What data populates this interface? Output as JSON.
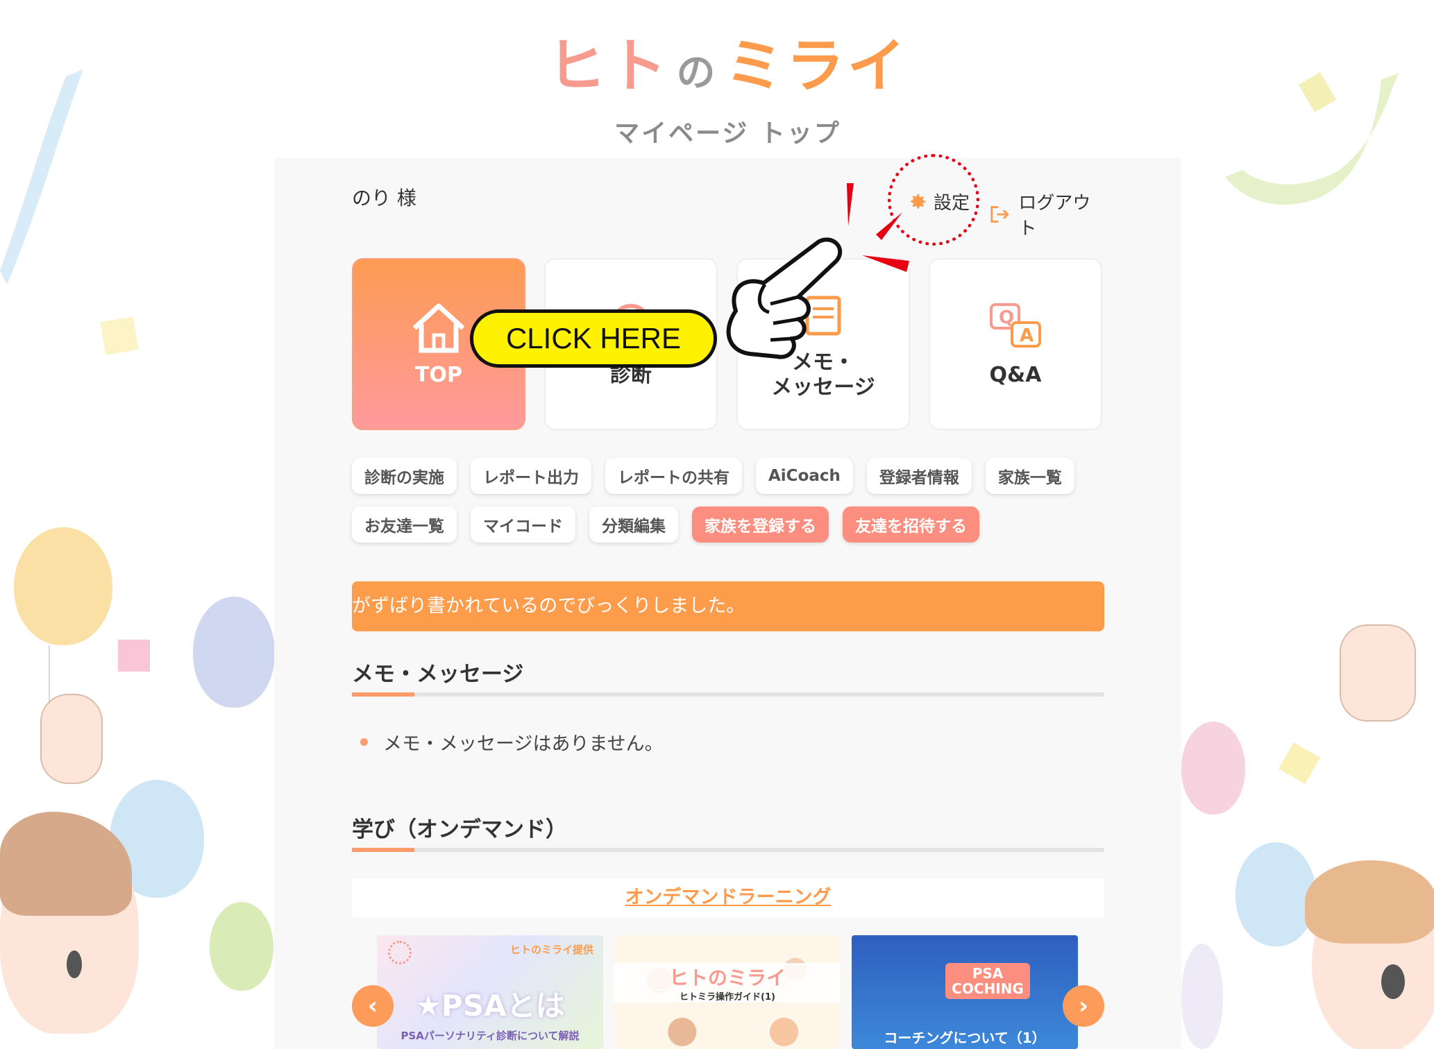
{
  "header": {
    "logo_hito": "ヒト",
    "logo_no": "の",
    "logo_mirai": "ミライ",
    "page_title": "マイページ トップ"
  },
  "user": {
    "name": "のり 様"
  },
  "actions": {
    "settings": "設定",
    "logout": "ログアウト"
  },
  "tiles": [
    {
      "label": "TOP",
      "icon": "home-icon",
      "active": true
    },
    {
      "label": "診断",
      "icon": "diagnosis-icon"
    },
    {
      "label": "メモ・\nメッセージ",
      "icon": "memo-icon"
    },
    {
      "label": "Q&A",
      "icon": "qa-icon"
    }
  ],
  "chips": [
    {
      "label": "診断の実施"
    },
    {
      "label": "レポート出力"
    },
    {
      "label": "レポートの共有"
    },
    {
      "label": "AiCoach"
    },
    {
      "label": "登録者情報"
    },
    {
      "label": "家族一覧"
    },
    {
      "label": "お友達一覧"
    },
    {
      "label": "マイコード"
    },
    {
      "label": "分類編集"
    },
    {
      "label": "家族を登録する",
      "highlight": true
    },
    {
      "label": "友達を招待する",
      "highlight": true
    }
  ],
  "banner": {
    "text": "がずばり書かれているのでびっくりしました。"
  },
  "memo": {
    "title": "メモ・メッセージ",
    "empty_text": "メモ・メッセージはありません。"
  },
  "learning": {
    "title": "学び（オンデマンド）",
    "link": "オンデマンドラーニング",
    "cards": [
      {
        "badge": "ヒトのミライ提供",
        "title": "★PSAとは",
        "subtitle": "PSAパーソナリティ診断について解説"
      },
      {
        "title": "ヒトのミライ",
        "subtitle": "ヒトミラ操作ガイド(1)"
      },
      {
        "title": "PSA\nCOCHING",
        "subtitle": "コーチングについて（1）"
      }
    ]
  },
  "overlay": {
    "click_here": "CLICK HERE"
  },
  "colors": {
    "accent": "#fd9c4a",
    "pink": "#fb8e7e",
    "annotation_red": "#e60012",
    "annotation_yellow": "#fff200"
  }
}
